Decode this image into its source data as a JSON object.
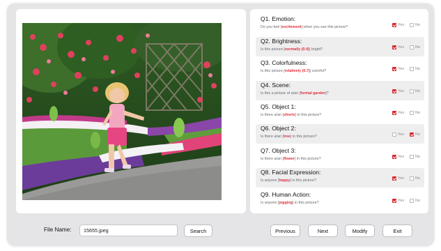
{
  "image_panel": {
    "photo_description": "girl-running-in-flower-garden"
  },
  "questions": [
    {
      "title": "Q1. Emotion:",
      "pre": "Do you feel [",
      "keyword": "excitement",
      "post": "] when you see this picture?",
      "yes_label": "Yes",
      "no_label": "No",
      "answer": "yes"
    },
    {
      "title": "Q2. Brightness:",
      "pre": "Is this picture [",
      "keyword": "normally (0.4)",
      "post": "] bright?",
      "yes_label": "Yes",
      "no_label": "No",
      "answer": "yes"
    },
    {
      "title": "Q3. Colorfulness:",
      "pre": "Is this picture [",
      "keyword": "relatively (0.7)",
      "post": "] colorful?",
      "yes_label": "Yes",
      "no_label": "No",
      "answer": "yes"
    },
    {
      "title": "Q4. Scene:",
      "pre": "Is this a picture of a/an [",
      "keyword": "formal garden",
      "post": "]?",
      "yes_label": "Yes",
      "no_label": "No",
      "answer": "yes"
    },
    {
      "title": "Q5. Object 1:",
      "pre": "Is there a/an [",
      "keyword": "shorts",
      "post": "] in this picture?",
      "yes_label": "Yes",
      "no_label": "No",
      "answer": "yes"
    },
    {
      "title": "Q6. Object 2:",
      "pre": "Is there a/an [",
      "keyword": "tree",
      "post": "] in this picture?",
      "yes_label": "Yes",
      "no_label": "No",
      "answer": "no"
    },
    {
      "title": "Q7. Object 3:",
      "pre": "Is there a/an [",
      "keyword": "flower",
      "post": "] in this picture?",
      "yes_label": "Yes",
      "no_label": "No",
      "answer": "yes"
    },
    {
      "title": "Q8. Facial Expression:",
      "pre": "Is anyone [",
      "keyword": "happy",
      "post": "] in this picture?",
      "yes_label": "Yes",
      "no_label": "No",
      "answer": "yes"
    },
    {
      "title": "Q9. Human Action:",
      "pre": "Is anyone [",
      "keyword": "jogging",
      "post": "] in this picture?",
      "yes_label": "Yes",
      "no_label": "No",
      "answer": "yes"
    }
  ],
  "bottom": {
    "file_name_label": "File Name:",
    "file_name_value": "15655.jpeg",
    "search_label": "Search",
    "previous_label": "Previous",
    "next_label": "Next",
    "modify_label": "Modify",
    "exit_label": "Exit"
  },
  "colors": {
    "accent": "#d9262f",
    "keyword": "#e0303a",
    "frame": "#e5e5e8",
    "alt_row": "#eeeeef"
  }
}
